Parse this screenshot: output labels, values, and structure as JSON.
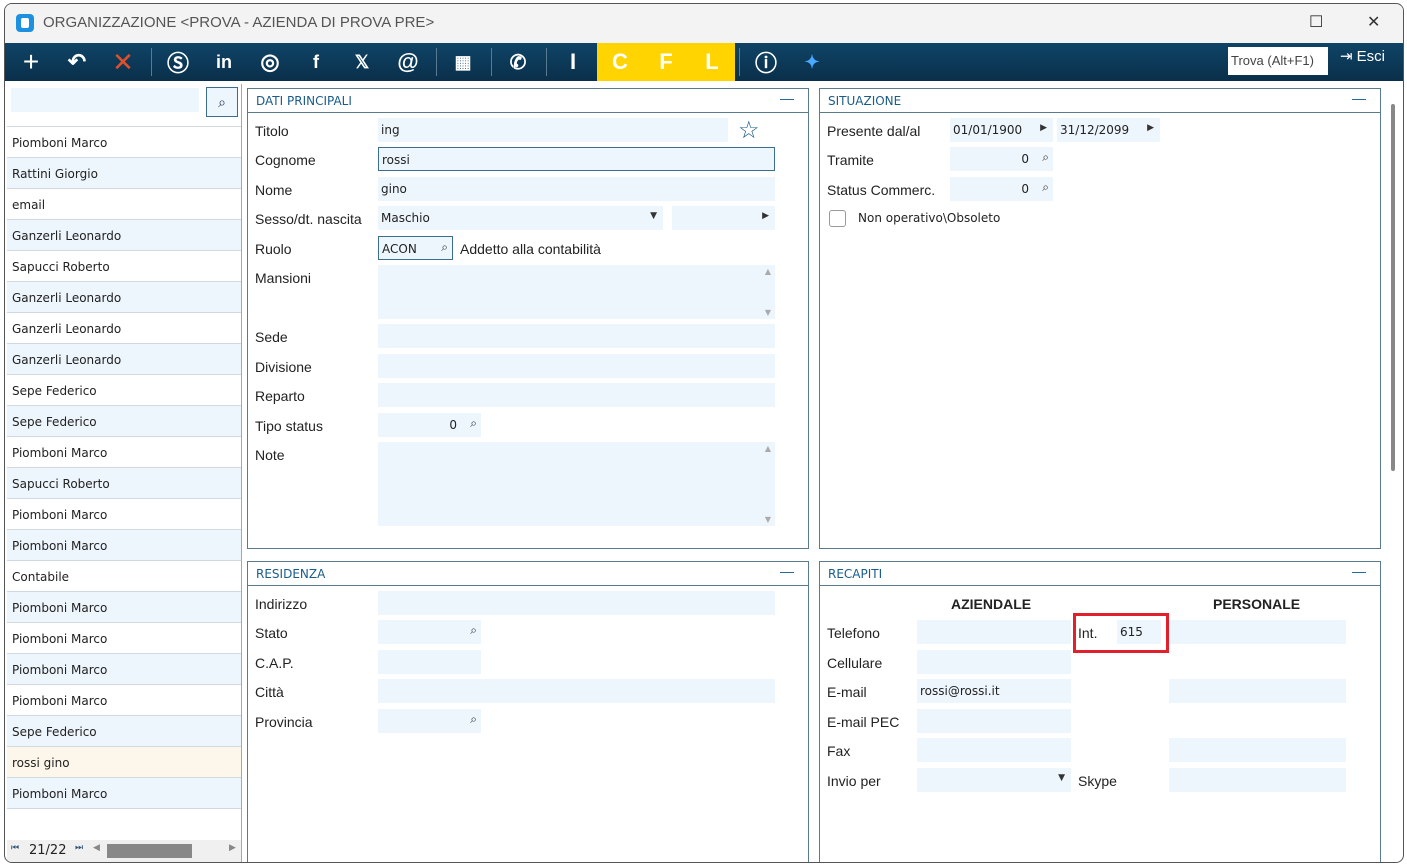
{
  "window": {
    "title": "ORGANIZZAZIONE <PROVA - AZIENDA DI PROVA PRE>"
  },
  "toolbar": {
    "find_label": "Trova (Alt+F1)",
    "exit_label": "Esci",
    "i": "I",
    "c": "C",
    "f": "F",
    "l": "L"
  },
  "list": {
    "items": [
      "Piomboni Marco",
      "Rattini  Giorgio",
      "email",
      "Ganzerli  Leonardo",
      "Sapucci Roberto",
      "Ganzerli  Leonardo",
      "Ganzerli  Leonardo",
      "Ganzerli  Leonardo",
      "Sepe Federico",
      "Sepe Federico",
      "Piomboni Marco",
      "Sapucci Roberto",
      "Piomboni Marco",
      "Piomboni Marco",
      "Contabile",
      "Piomboni Marco",
      "Piomboni Marco",
      "Piomboni Marco",
      "Piomboni Marco",
      "Sepe Federico",
      "rossi gino",
      "Piomboni Marco"
    ],
    "selected_index": 20,
    "pager": "21/22"
  },
  "dati": {
    "title": "DATI PRINCIPALI",
    "titolo_l": "Titolo",
    "titolo": "ing",
    "cognome_l": "Cognome",
    "cognome": "rossi",
    "nome_l": "Nome",
    "nome": "gino",
    "sesso_l": "Sesso/dt. nascita",
    "sesso": "Maschio",
    "ruolo_l": "Ruolo",
    "ruolo": "ACON",
    "ruolo_desc": "Addetto alla contabilità",
    "mansioni_l": "Mansioni",
    "sede_l": "Sede",
    "divisione_l": "Divisione",
    "reparto_l": "Reparto",
    "tipo_l": "Tipo status",
    "tipo": "0",
    "note_l": "Note"
  },
  "situazione": {
    "title": "SITUAZIONE",
    "presente_l": "Presente dal/al",
    "dal": "01/01/1900",
    "al": "31/12/2099",
    "tramite_l": "Tramite",
    "tramite": "0",
    "status_l": "Status Commerc.",
    "status": "0",
    "obsoleto_l": "Non operativo\\Obsoleto"
  },
  "residenza": {
    "title": "RESIDENZA",
    "indirizzo_l": "Indirizzo",
    "stato_l": "Stato",
    "cap_l": "C.A.P.",
    "citta_l": "Città",
    "provincia_l": "Provincia"
  },
  "recapiti": {
    "title": "RECAPITI",
    "aziendale": "AZIENDALE",
    "personale": "PERSONALE",
    "telefono_l": "Telefono",
    "int_l": "Int.",
    "int": "615",
    "cellulare_l": "Cellulare",
    "email_l": "E-mail",
    "email": "rossi@rossi.it",
    "pec_l": "E-mail PEC",
    "fax_l": "Fax",
    "invio_l": "Invio per",
    "skype_l": "Skype"
  },
  "colors": {
    "toolbar": "#0f4467",
    "yellow": "#ffd400",
    "field": "#eef6fd",
    "highlight": "#e0202a"
  }
}
